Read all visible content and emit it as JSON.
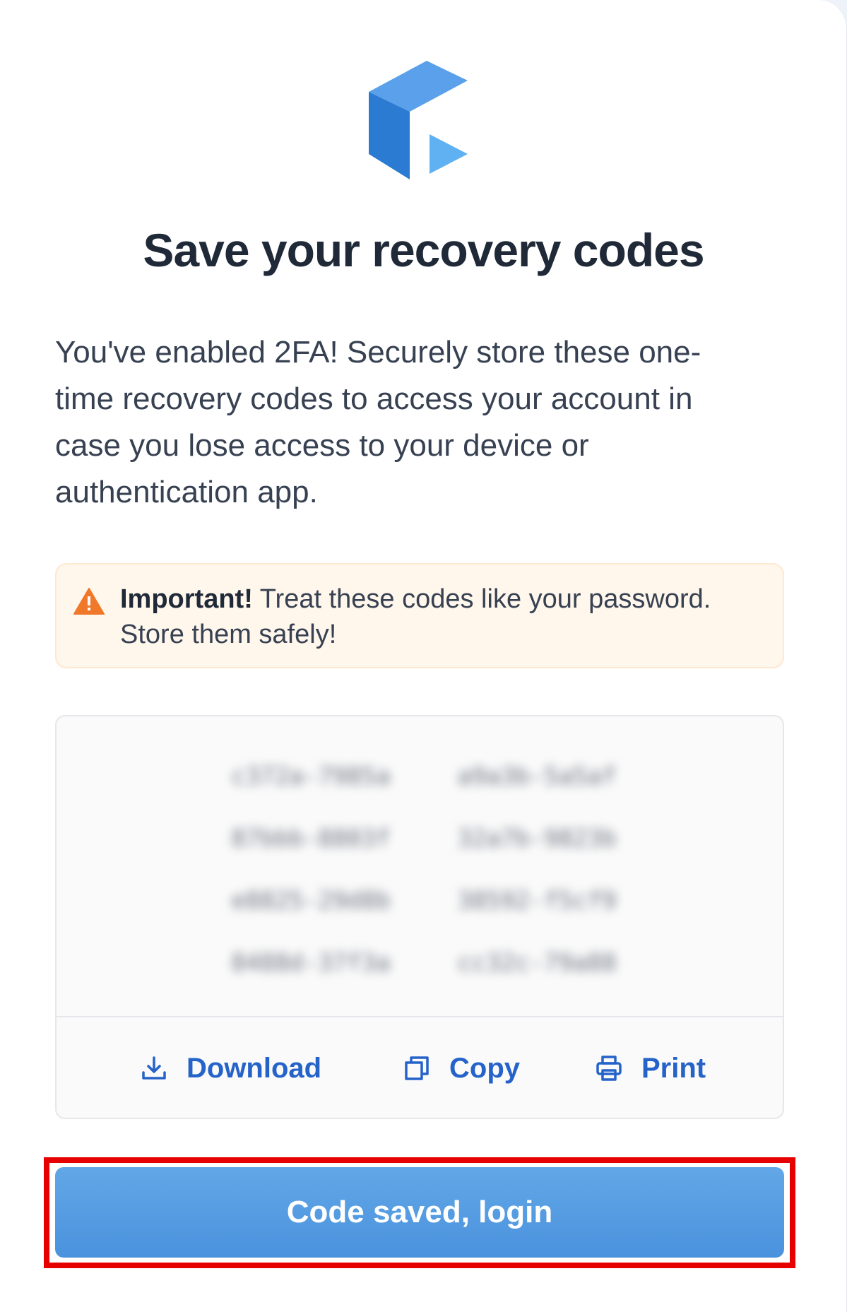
{
  "title": "Save your recovery codes",
  "description": "You've enabled 2FA! Securely store these one-time recovery codes to access your account in case you lose access to your device or authentication app.",
  "alert": {
    "strong": "Important!",
    "text": " Treat these codes like your password. Store them safely!"
  },
  "recovery_codes": [
    "c372a-7985a",
    "a9a3b-5a5af",
    "87bbb-8803f",
    "32a7b-9823b",
    "e8825-29d8b",
    "38592-f5cf9",
    "8488d-37f3a",
    "cc32c-79a88"
  ],
  "actions": {
    "download_label": "Download",
    "copy_label": "Copy",
    "print_label": "Print"
  },
  "cta_label": "Code saved, login",
  "colors": {
    "accent": "#2563c9",
    "button": "#4a92de",
    "warning": "#f0782a",
    "highlight": "#e60000"
  }
}
